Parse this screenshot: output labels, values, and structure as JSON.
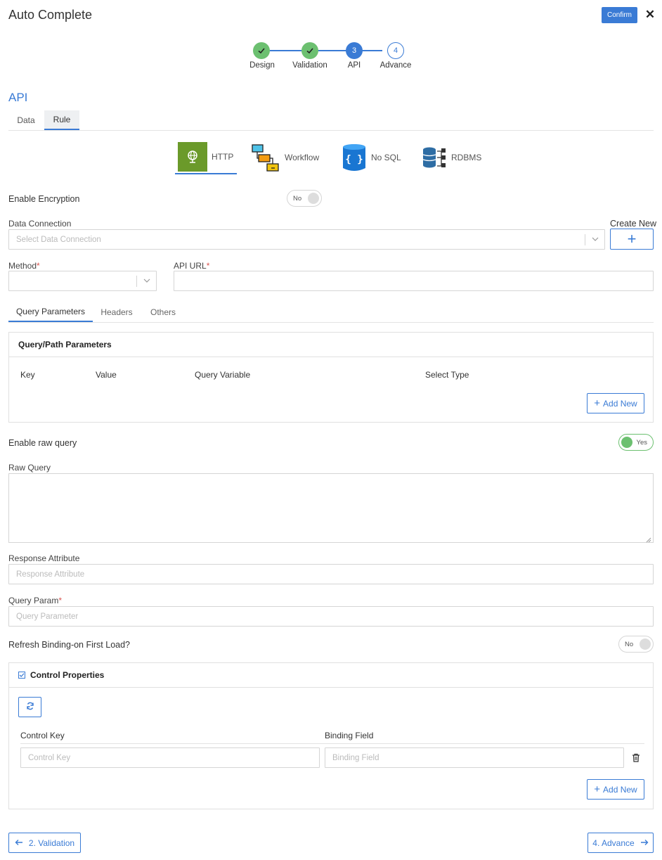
{
  "header": {
    "title": "Auto Complete",
    "confirm_label": "Confirm",
    "close_glyph": "✕"
  },
  "stepper": {
    "steps": [
      {
        "label": "Design",
        "state": "done",
        "mark": ""
      },
      {
        "label": "Validation",
        "state": "done",
        "mark": ""
      },
      {
        "label": "API",
        "state": "active",
        "mark": "3"
      },
      {
        "label": "Advance",
        "state": "todo",
        "mark": "4"
      }
    ]
  },
  "section": {
    "title": "API",
    "tabs": [
      {
        "label": "Data"
      },
      {
        "label": "Rule"
      }
    ]
  },
  "sources": [
    {
      "label": "HTTP",
      "icon": "globe-icon",
      "selected": true
    },
    {
      "label": "Workflow",
      "icon": "workflow-icon"
    },
    {
      "label": "No SQL",
      "icon": "nosql-icon"
    },
    {
      "label": "RDBMS",
      "icon": "rdbms-icon"
    }
  ],
  "encryption": {
    "label": "Enable Encryption",
    "toggle_label": "No"
  },
  "data_connection": {
    "label": "Data Connection",
    "placeholder": "Select Data Connection",
    "create_label": "Create New",
    "create_glyph": "+"
  },
  "method": {
    "label": "Method",
    "required": "*"
  },
  "api_url": {
    "label": "API URL",
    "required": "*"
  },
  "request_tabs": [
    {
      "label": "Query Parameters"
    },
    {
      "label": "Headers"
    },
    {
      "label": "Others"
    }
  ],
  "query_params": {
    "title": "Query/Path Parameters",
    "columns": [
      "Key",
      "Value",
      "Query Variable",
      "Select Type"
    ],
    "add_label": "Add New"
  },
  "raw_query": {
    "toggle_title": "Enable raw query",
    "toggle_label": "Yes",
    "label": "Raw Query"
  },
  "response_attribute": {
    "label": "Response Attribute",
    "placeholder": "Response Attribute"
  },
  "query_param": {
    "label": "Query Param",
    "required": "*",
    "placeholder": "Query Parameter"
  },
  "refresh_binding": {
    "label": "Refresh Binding-on First Load?",
    "toggle_label": "No"
  },
  "control_properties": {
    "title": "Control Properties",
    "columns": [
      "Control Key",
      "Binding Field"
    ],
    "control_key_placeholder": "Control Key",
    "binding_field_placeholder": "Binding Field",
    "add_label": "Add New"
  },
  "footer": {
    "prev_label": "2. Validation",
    "next_label": "4. Advance"
  },
  "colors": {
    "accent": "#3a7bd5",
    "success": "#6cc070",
    "required": "#d9534f"
  }
}
